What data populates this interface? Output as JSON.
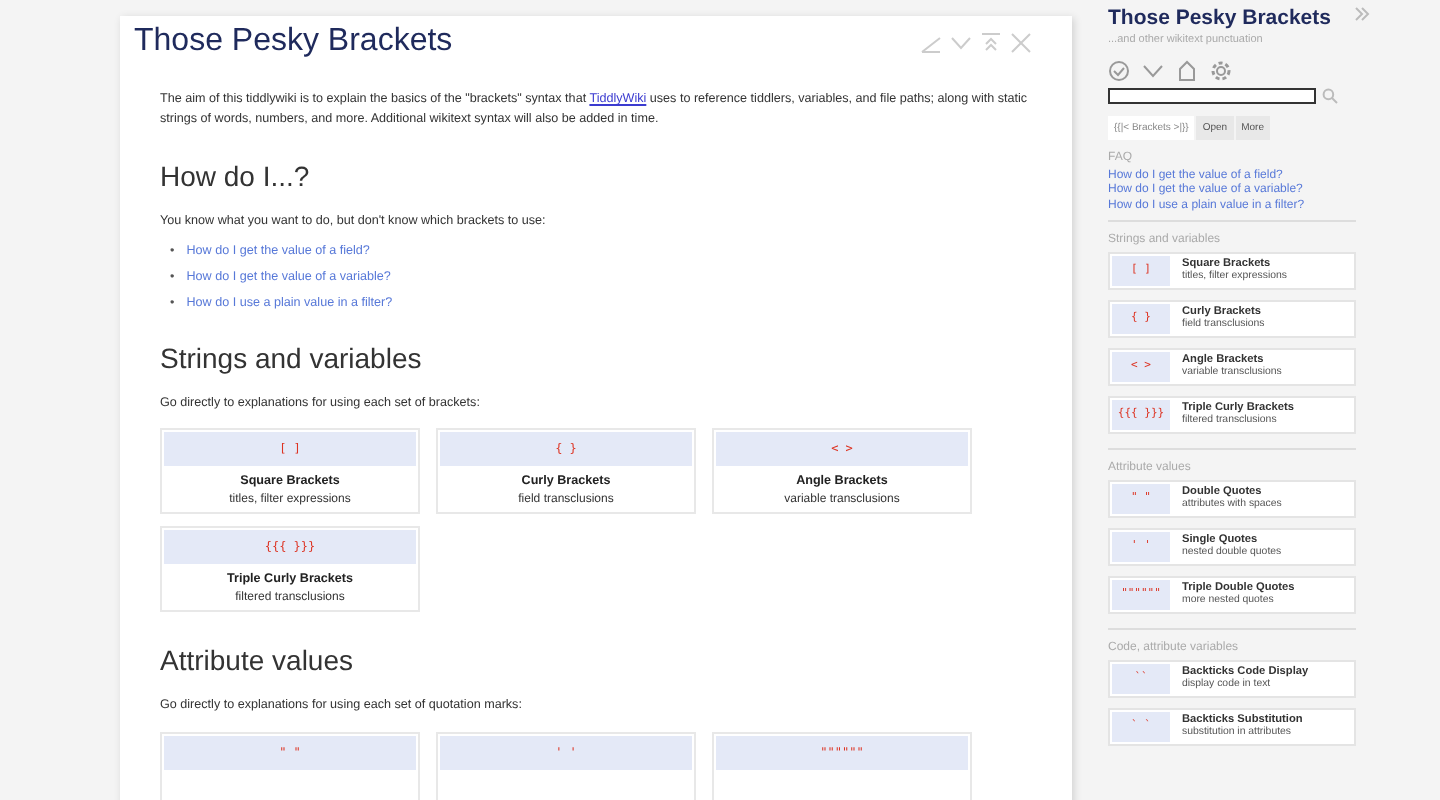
{
  "story": {
    "title": "Those Pesky Brackets",
    "intro": {
      "before": "The aim of this tiddlywiki is to explain the basics of the \"brackets\" syntax that",
      "link": "TiddlyWiki",
      "after": "uses to reference tiddlers, variables, and file paths; along with static strings of words, numbers, and more. Additional wikitext syntax will also be added in time."
    },
    "sections": [
      {
        "heading": "How do I...?",
        "lead": "You know what you want to do, but don't know which brackets to use:",
        "links": [
          {
            "bullet": "•",
            "text": "How do I get the value of a field?"
          },
          {
            "bullet": "•",
            "text": "How do I get the value of a variable?"
          },
          {
            "bullet": "•",
            "text": "How do I use a plain value in a filter?"
          }
        ]
      },
      {
        "heading": "Strings and variables",
        "lead": "Go directly to explanations for using each set of brackets:",
        "cards": [
          {
            "glyph": "[ ]",
            "title": "Square Brackets",
            "subtitle": "titles, filter expressions"
          },
          {
            "glyph": "{ }",
            "title": "Curly Brackets",
            "subtitle": "field transclusions"
          },
          {
            "glyph": "< >",
            "title": "Angle Brackets",
            "subtitle": "variable transclusions"
          },
          {
            "glyph": "{{{ }}}",
            "title": "Triple Curly Brackets",
            "subtitle": "filtered transclusions"
          }
        ]
      },
      {
        "heading": "Attribute values",
        "lead": "Go directly to explanations for using each set of quotation marks:",
        "cards": [
          {
            "glyph": "\" \""
          },
          {
            "glyph": "' '"
          },
          {
            "glyph": "\"\"\"\"\"\""
          }
        ]
      }
    ]
  },
  "sidebar": {
    "title": "Those Pesky Brackets",
    "subtitle": "...and other wikitext punctuation",
    "tabs": [
      {
        "label": "{{|< Brackets >|}}",
        "selected": true
      },
      {
        "label": "Open",
        "selected": false
      },
      {
        "label": "More",
        "selected": false
      }
    ],
    "faq_heading": "FAQ",
    "faq_links": [
      "How do I get the value of a field?",
      "How do I get the value of a variable?",
      "How do I use a plain value in a filter?"
    ],
    "groups": [
      {
        "heading": "Strings and variables",
        "cards": [
          {
            "glyph": "[ ]",
            "title": "Square Brackets",
            "subtitle": "titles, filter expressions"
          },
          {
            "glyph": "{ }",
            "title": "Curly Brackets",
            "subtitle": "field transclusions"
          },
          {
            "glyph": "< >",
            "title": "Angle Brackets",
            "subtitle": "variable transclusions"
          },
          {
            "glyph": "{{{ }}}",
            "title": "Triple Curly Brackets",
            "subtitle": "filtered transclusions"
          }
        ]
      },
      {
        "heading": "Attribute values",
        "cards": [
          {
            "glyph": "\" \"",
            "title": "Double Quotes",
            "subtitle": "attributes with spaces"
          },
          {
            "glyph": "' '",
            "title": "Single Quotes",
            "subtitle": "nested double quotes"
          },
          {
            "glyph": "\"\"\"\"\"\"",
            "title": "Triple Double Quotes",
            "subtitle": "more nested quotes"
          }
        ]
      },
      {
        "heading": "Code, attribute variables",
        "cards": [
          {
            "glyph": "``",
            "title": "Backticks Code Display",
            "subtitle": "display code in text"
          },
          {
            "glyph": "` `",
            "title": "Backticks Substitution",
            "subtitle": "substitution in attributes"
          }
        ]
      }
    ]
  }
}
